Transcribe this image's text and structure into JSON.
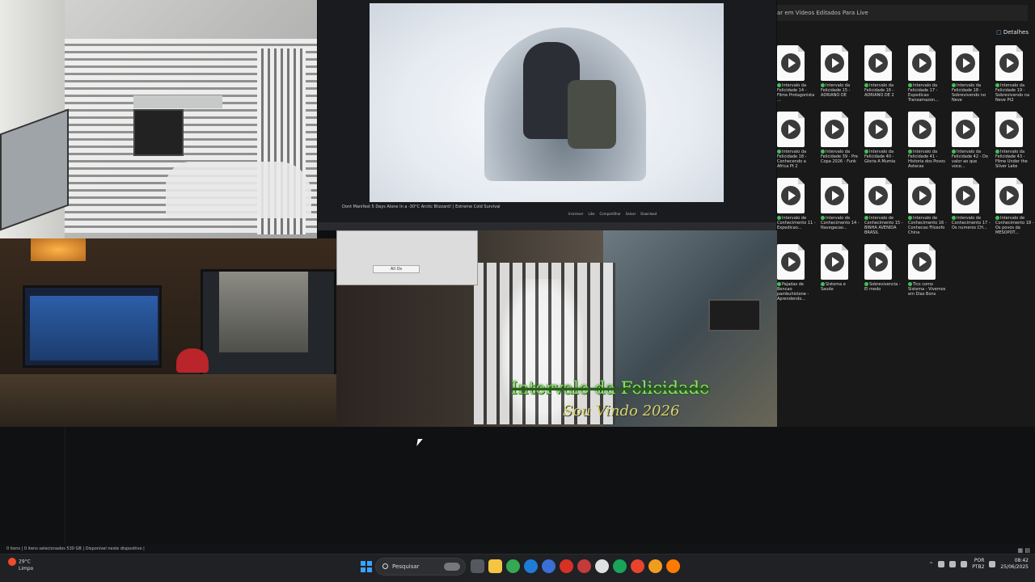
{
  "explorer": {
    "address": "ar em Vídeos Editados Para Live",
    "details_label": "Detalhes",
    "files": [
      {
        "name": "Intervalo da Felicidade 14 - Filme Protagonista ..."
      },
      {
        "name": "Intervalo da Felicidade 15 - ADRIANO DE"
      },
      {
        "name": "Intervalo da Felicidade 16 - ADRIANO DE 2"
      },
      {
        "name": "Intervalo da Felicidade 17 - Expedicao Transamazon..."
      },
      {
        "name": "Intervalo da Felicidade 18 - Sobrevivendo no Neve"
      },
      {
        "name": "Intervalo da Felicidade 19 - Sobrevivendo na Neve Pt2"
      },
      {
        "name": "Intervalo da Felicidade 18 - Conhecendo a Africa Pt 2"
      },
      {
        "name": "Intervalo da Felicidade 39 - Pre Copa 2026 - Funk"
      },
      {
        "name": "Intervalo da Felicidade 40 - Gloria A Mumia"
      },
      {
        "name": "Intervalo da Felicidade 41 - Historia dos Povos Astecas"
      },
      {
        "name": "Intervalo da Felicidade 42 - Do valor ao que voce..."
      },
      {
        "name": "Intervalo da Felicidade 43 - Filme Under the Silver Lake"
      },
      {
        "name": "Intervalo de Conhecimento 11 - Expedicao..."
      },
      {
        "name": "Intervalo de Conhecimento 14 - Navegacao..."
      },
      {
        "name": "Intervalo de Conhecimento 15 - BINHA AVENIDA BRASIL"
      },
      {
        "name": "Intervalo de Conhecimento 16 - Conhecao Filosofo China"
      },
      {
        "name": "Intervalo de Conhecimento 17 - Os numeros CH..."
      },
      {
        "name": "Intervalo de Conhecimento 18 - Os povos da MESOPOT..."
      },
      {
        "name": "Pajadas de Bencao pambuhistone - Aprendendo..."
      },
      {
        "name": "Sistema e Saude"
      },
      {
        "name": "Sobrevivencia - El medo"
      },
      {
        "name": "Tics como Sistema - Vivemos em Dias Bons"
      }
    ]
  },
  "video": {
    "title": "Dont Manifest 5 Days Alone In a -30°C Arctic Blizzard! | Extreme Cold Survival",
    "actions": [
      "Inscrever",
      "Like",
      "Compartilhar",
      "Salvar",
      "Download"
    ]
  },
  "overlay": {
    "title": "Intervalo da Felicidade",
    "subtitle": "Sou Vindo 2026"
  },
  "dialog": {
    "button": "All Os"
  },
  "status": {
    "text": "0 itens  |  0 itens selecionados  530 GB  |  Disponível neste dispositivo  |"
  },
  "taskbar": {
    "weather_temp": "29°C",
    "weather_desc": "Limpo",
    "search_placeholder": "Pesquisar",
    "lang": "POR",
    "lang2": "PTB2",
    "time": "08:42",
    "date": "25/06/2025",
    "icons": [
      "task-view-icon",
      "file-explorer-icon",
      "chrome-icon",
      "edge-icon",
      "store-icon",
      "app-icon-1",
      "app-icon-2",
      "app-icon-3",
      "app-icon-4",
      "app-icon-5",
      "app-icon-6",
      "vlc-icon"
    ]
  },
  "colors": {
    "accent": "#3aa3ff",
    "overlay_green": "#8fe36b",
    "overlay_gold": "#d8d46a"
  }
}
